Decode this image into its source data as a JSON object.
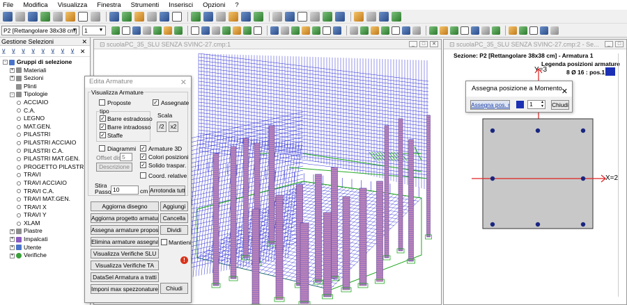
{
  "menu": [
    "File",
    "Modifica",
    "Visualizza",
    "Finestra",
    "Strumenti",
    "Inserisci",
    "Opzioni",
    "?"
  ],
  "toolbar": {
    "section_combo": "P2 [Rettangolare 38x38 cm]",
    "number_combo": "1"
  },
  "left_panel": {
    "title": "Gestione Selezioni",
    "tree": [
      {
        "label": "Gruppi di selezione",
        "level": 0,
        "expander": "-",
        "icon": "blue",
        "bold": true
      },
      {
        "label": "Materiali",
        "level": 1,
        "expander": "+",
        "icon": "gray"
      },
      {
        "label": "Sezioni",
        "level": 1,
        "expander": "+",
        "icon": "gray"
      },
      {
        "label": "Plinti",
        "level": 1,
        "expander": "",
        "icon": "gray"
      },
      {
        "label": "Tipologie",
        "level": 1,
        "expander": "-",
        "icon": "gray"
      },
      {
        "label": "ACCIAIO",
        "level": 2,
        "expander": "",
        "icon": "leaf"
      },
      {
        "label": "C.A.",
        "level": 2,
        "expander": "",
        "icon": "leaf"
      },
      {
        "label": "LEGNO",
        "level": 2,
        "expander": "",
        "icon": "leaf"
      },
      {
        "label": "MAT.GEN.",
        "level": 2,
        "expander": "",
        "icon": "leaf"
      },
      {
        "label": "PILASTRI",
        "level": 2,
        "expander": "",
        "icon": "leaf"
      },
      {
        "label": "PILASTRI ACCIAIO",
        "level": 2,
        "expander": "",
        "icon": "leaf"
      },
      {
        "label": "PILASTRI C.A.",
        "level": 2,
        "expander": "",
        "icon": "leaf"
      },
      {
        "label": "PILASTRI MAT.GEN.",
        "level": 2,
        "expander": "",
        "icon": "leaf"
      },
      {
        "label": "PROGETTO PILASTRI",
        "level": 2,
        "expander": "",
        "icon": "leaf"
      },
      {
        "label": "TRAVI",
        "level": 2,
        "expander": "",
        "icon": "leaf"
      },
      {
        "label": "TRAVI ACCIAIO",
        "level": 2,
        "expander": "",
        "icon": "leaf"
      },
      {
        "label": "TRAVI C.A.",
        "level": 2,
        "expander": "",
        "icon": "leaf"
      },
      {
        "label": "TRAVI MAT.GEN.",
        "level": 2,
        "expander": "",
        "icon": "leaf"
      },
      {
        "label": "TRAVI X",
        "level": 2,
        "expander": "",
        "icon": "leaf"
      },
      {
        "label": "TRAVI Y",
        "level": 2,
        "expander": "",
        "icon": "leaf"
      },
      {
        "label": "XLAM",
        "level": 2,
        "expander": "",
        "icon": "leaf"
      },
      {
        "label": "Piastre",
        "level": 1,
        "expander": "+",
        "icon": "gray"
      },
      {
        "label": "Impalcati",
        "level": 1,
        "expander": "+",
        "icon": "purple"
      },
      {
        "label": "Utente",
        "level": 1,
        "expander": "+",
        "icon": "blue"
      },
      {
        "label": "Verifiche",
        "level": 1,
        "expander": "+",
        "icon": "green"
      }
    ]
  },
  "window1": {
    "title": "scuolaPC_35_SLU SENZA SVINC-27.cmp:1"
  },
  "window2": {
    "title": "scuolaPC_35_SLU SENZA SVINC-27.cmp:2 - Se...",
    "section_label": "Sezione: P2 [Rettangolare 38x38 cm] - Armatura 1",
    "legend_title": "Legenda posizioni armature",
    "legend_entry": "8 Ø 16 : pos.1",
    "axis_y": "Y=3",
    "axis_x": "X=2"
  },
  "dialog_armature": {
    "title": "Edita Armature",
    "group_label": "Visualizza Armature",
    "proposte": "Proposte",
    "assegnate": "Assegnate",
    "tipo": "tipo",
    "barre_estradosso": "Barre estradosso",
    "barre_intradosso": "Barre intradosso",
    "staffe": "Staffe",
    "scala": "Scala",
    "scala_half": "/2",
    "scala_double": "x2",
    "diagrammi": "Diagrammi",
    "armature_3d": "Armature 3D",
    "offset_label": "Offset dis.",
    "offset_value": "5",
    "descrizione": "Descrizione",
    "colori_posizioni": "Colori posizioni",
    "solido_traspar": "Solido traspar.",
    "coord_relative": "Coord. relative",
    "stira": "Stira",
    "passo": "Passo",
    "passo_value": "10",
    "passo_unit": "cm",
    "arrotonda": "Arrotonda tutto",
    "aggiorna_disegno": "Aggiorna disegno",
    "aggiungi": "Aggiungi",
    "aggiorna_progetto": "Aggiorna progetto armature",
    "cancella": "Cancella",
    "assegna_proposte": "Assegna armature proposte",
    "dividi": "Dividi",
    "elimina_assegnate": "Elimina armature assegnate",
    "mantieni": "Mantieni",
    "verifiche_slu": "Visualizza Verifiche SLU",
    "verifiche_ta": "Visualizza Verifiche TA",
    "datasel": "DataSel Armatura a tratti",
    "imponi": "Imponi max spezzonature",
    "chiudi": "Chiudi"
  },
  "dialog_momento": {
    "title": "Assegna posizione a Momento",
    "assegna_pos": "Assegna pos. n°",
    "pos_value": "1",
    "chiudi": "Chiudi"
  },
  "colors": {
    "mesh": "#2a2ad4",
    "column": "#c78bb5",
    "green": "#22a822",
    "legend_square": "#1b2fb5",
    "bar_dot": "#1a2680",
    "section_fill": "#c8c8c8"
  }
}
